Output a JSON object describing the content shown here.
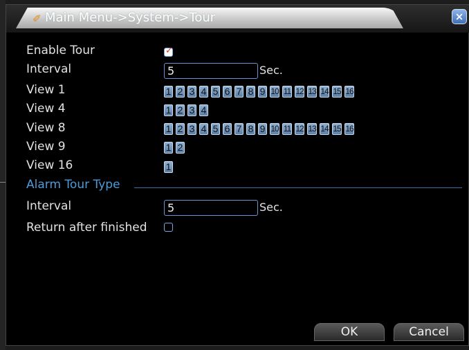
{
  "window": {
    "title": "Main Menu->System->Tour",
    "close_label": "×"
  },
  "labels": {
    "enable_tour": "Enable Tour",
    "interval": "Interval",
    "view1": "View 1",
    "view4": "View 4",
    "view8": "View 8",
    "view9": "View 9",
    "view16": "View 16",
    "alarm_tour_type": "Alarm Tour Type",
    "alarm_interval": "Interval",
    "return_after_finished": "Return after finished"
  },
  "fields": {
    "interval_value": "5",
    "interval_unit": "Sec.",
    "alarm_interval_value": "5",
    "alarm_interval_unit": "Sec.",
    "enable_tour_checked": true,
    "return_after_finished_checked": false
  },
  "channels": {
    "view1": [
      "1",
      "2",
      "3",
      "4",
      "5",
      "6",
      "7",
      "8",
      "9",
      "10",
      "11",
      "12",
      "13",
      "14",
      "15",
      "16"
    ],
    "view4": [
      "1",
      "2",
      "3",
      "4"
    ],
    "view8": [
      "1",
      "2",
      "3",
      "4",
      "5",
      "6",
      "7",
      "8",
      "9",
      "10",
      "11",
      "12",
      "13",
      "14",
      "15",
      "16"
    ],
    "view9": [
      "1",
      "2"
    ],
    "view16": [
      "1"
    ]
  },
  "buttons": {
    "ok": "OK",
    "cancel": "Cancel"
  },
  "colors": {
    "accent": "#4d9bd8",
    "check": "#d4332b",
    "channel": "#7a9cc2"
  }
}
